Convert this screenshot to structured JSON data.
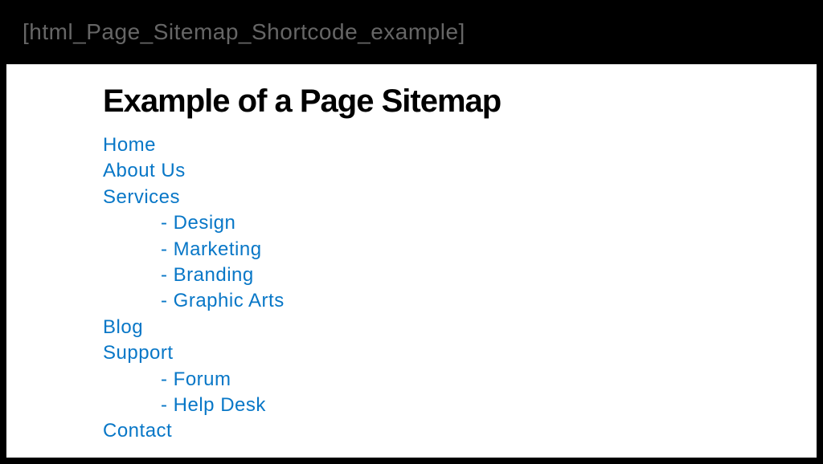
{
  "header": {
    "label": "[html_Page_Sitemap_Shortcode_example]"
  },
  "page": {
    "title": "Example of a Page Sitemap"
  },
  "sitemap": {
    "items": [
      {
        "label": "Home",
        "children": []
      },
      {
        "label": "About Us",
        "children": []
      },
      {
        "label": "Services",
        "children": [
          {
            "label": "Design"
          },
          {
            "label": " Marketing"
          },
          {
            "label": "Branding"
          },
          {
            "label": "Graphic Arts"
          }
        ]
      },
      {
        "label": "Blog",
        "children": []
      },
      {
        "label": "Support",
        "children": [
          {
            "label": "Forum"
          },
          {
            "label": "Help Desk"
          }
        ]
      },
      {
        "label": "Contact",
        "children": []
      }
    ]
  }
}
